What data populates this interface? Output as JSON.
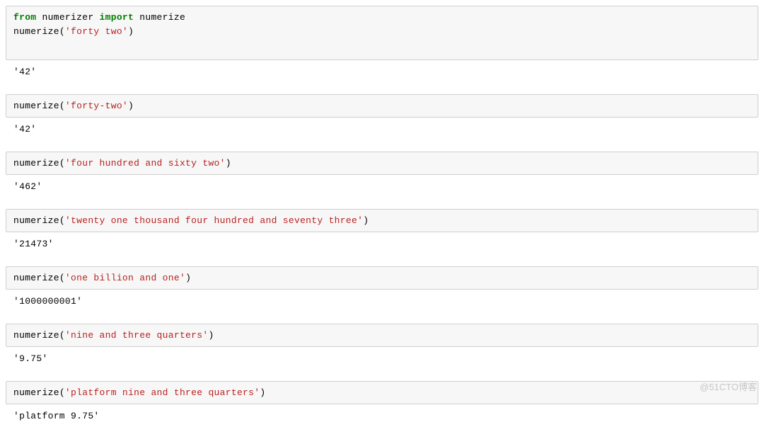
{
  "cells": [
    {
      "in": [
        {
          "kind": "code",
          "tokens": [
            {
              "t": "from ",
              "c": "kw-from"
            },
            {
              "t": "numerizer ",
              "c": ""
            },
            {
              "t": "import ",
              "c": "kw-import"
            },
            {
              "t": "numerize",
              "c": ""
            }
          ]
        },
        {
          "kind": "code",
          "tokens": [
            {
              "t": "numerize",
              "c": ""
            },
            {
              "t": "(",
              "c": "paren"
            },
            {
              "t": "'forty two'",
              "c": "str"
            },
            {
              "t": ")",
              "c": "paren"
            }
          ]
        }
      ],
      "out": "'42'",
      "first": true
    },
    {
      "in": [
        {
          "kind": "code",
          "tokens": [
            {
              "t": "numerize",
              "c": ""
            },
            {
              "t": "(",
              "c": "paren"
            },
            {
              "t": "'forty-two'",
              "c": "str"
            },
            {
              "t": ")",
              "c": "paren"
            }
          ]
        }
      ],
      "out": "'42'"
    },
    {
      "in": [
        {
          "kind": "code",
          "tokens": [
            {
              "t": "numerize",
              "c": ""
            },
            {
              "t": "(",
              "c": "paren"
            },
            {
              "t": "'four hundred and sixty two'",
              "c": "str"
            },
            {
              "t": ")",
              "c": "paren"
            }
          ]
        }
      ],
      "out": "'462'"
    },
    {
      "in": [
        {
          "kind": "code",
          "tokens": [
            {
              "t": "numerize",
              "c": ""
            },
            {
              "t": "(",
              "c": "paren"
            },
            {
              "t": "'twenty one thousand four hundred and seventy three'",
              "c": "str"
            },
            {
              "t": ")",
              "c": "paren"
            }
          ]
        }
      ],
      "out": "'21473'"
    },
    {
      "in": [
        {
          "kind": "code",
          "tokens": [
            {
              "t": "numerize",
              "c": ""
            },
            {
              "t": "(",
              "c": "paren"
            },
            {
              "t": "'one billion and one'",
              "c": "str"
            },
            {
              "t": ")",
              "c": "paren"
            }
          ]
        }
      ],
      "out": "'1000000001'"
    },
    {
      "in": [
        {
          "kind": "code",
          "tokens": [
            {
              "t": "numerize",
              "c": ""
            },
            {
              "t": "(",
              "c": "paren"
            },
            {
              "t": "'nine and three quarters'",
              "c": "str"
            },
            {
              "t": ")",
              "c": "paren"
            }
          ]
        }
      ],
      "out": "'9.75'"
    },
    {
      "in": [
        {
          "kind": "code",
          "tokens": [
            {
              "t": "numerize",
              "c": ""
            },
            {
              "t": "(",
              "c": "paren"
            },
            {
              "t": "'platform nine and three quarters'",
              "c": "str"
            },
            {
              "t": ")",
              "c": "paren"
            }
          ]
        }
      ],
      "out": "'platform 9.75'"
    }
  ],
  "watermark": "@51CTO博客"
}
